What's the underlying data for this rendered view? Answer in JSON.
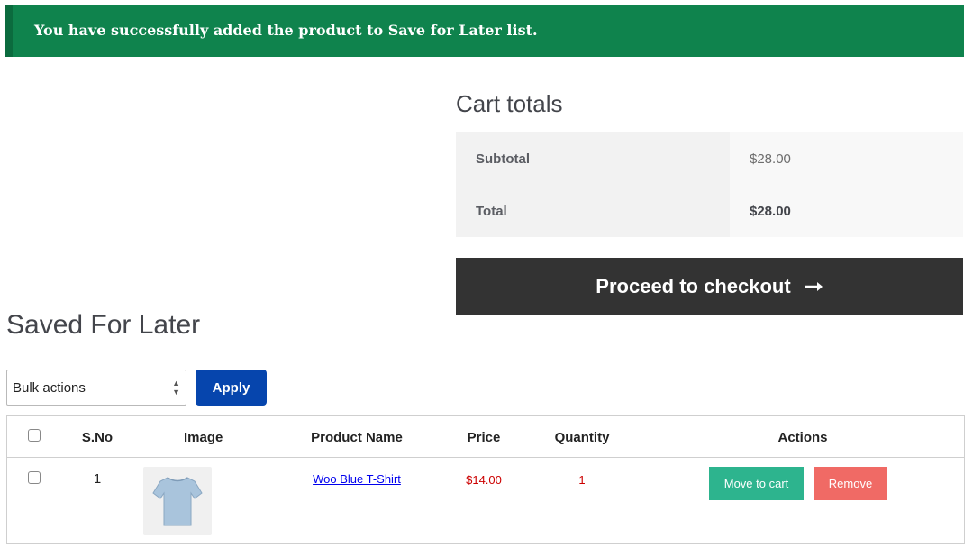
{
  "notice": {
    "message": "You have successfully added the product to Save for Later list."
  },
  "cart_totals": {
    "title": "Cart totals",
    "rows": [
      {
        "label": "Subtotal",
        "value": "$28.00"
      },
      {
        "label": "Total",
        "value": "$28.00"
      }
    ],
    "checkout_label": "Proceed to checkout",
    "checkout_icon": "arrow-right-icon"
  },
  "saved": {
    "title": "Saved For Later",
    "bulk_select": "Bulk actions",
    "apply_label": "Apply",
    "columns": [
      "S.No",
      "Image",
      "Product Name",
      "Price",
      "Quantity",
      "Actions"
    ],
    "items": [
      {
        "sno": "1",
        "image": "blue-tshirt-image",
        "name": "Woo Blue T-Shirt",
        "price": "$14.00",
        "quantity": "1",
        "move_label": "Move to cart",
        "remove_label": "Remove"
      }
    ]
  },
  "colors": {
    "notice_bg": "#0f834d",
    "apply_bg": "#0645ad",
    "move_bg": "#2db48e",
    "remove_bg": "#f06a65",
    "checkout_bg": "#333333"
  }
}
